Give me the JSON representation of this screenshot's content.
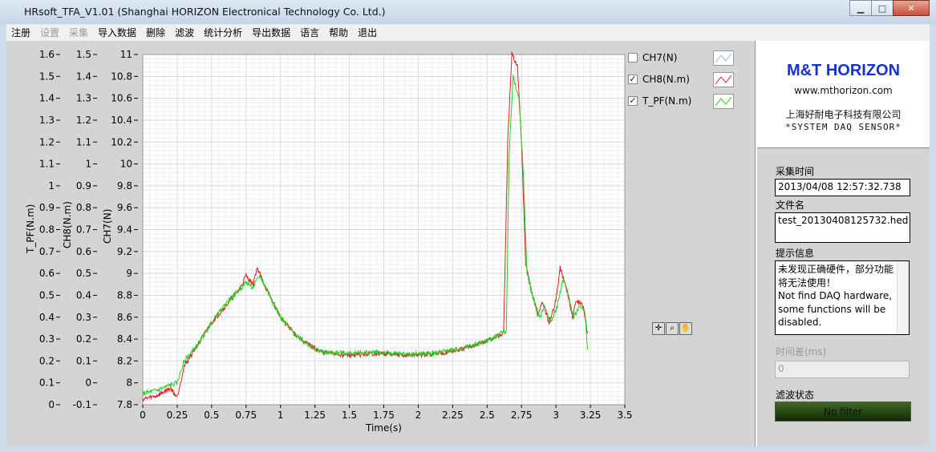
{
  "window": {
    "title": "HRsoft_TFA_V1.01 (Shanghai HORIZON Electronical Technology Co. Ltd.)",
    "min_label": "▁",
    "max_label": "□",
    "close_label": "✕"
  },
  "menu": [
    {
      "label": "注册",
      "enabled": true
    },
    {
      "label": "设置",
      "enabled": false
    },
    {
      "label": "采集",
      "enabled": false
    },
    {
      "label": "导入数据",
      "enabled": true
    },
    {
      "label": "删除",
      "enabled": true
    },
    {
      "label": "滤波",
      "enabled": true
    },
    {
      "label": "统计分析",
      "enabled": true
    },
    {
      "label": "导出数据",
      "enabled": true
    },
    {
      "label": "语言",
      "enabled": true
    },
    {
      "label": "帮助",
      "enabled": true
    },
    {
      "label": "退出",
      "enabled": true
    }
  ],
  "brand": {
    "name": "M&T HORIZON",
    "url": "www.mthorizon.com",
    "company": "上海好耐电子科技有限公司",
    "slogan": "*SYSTEM  DAQ  SENSOR*"
  },
  "panel": {
    "acq_time_label": "采集时间",
    "acq_time_value": "2013/04/08 12:57:32.738",
    "filename_label": "文件名",
    "filename_value": "test_20130408125732.hed",
    "message_label": "提示信息",
    "message_lines": [
      "未发现正确硬件，部分功能",
      "将无法使用！",
      "Not find DAQ hardware,",
      "some functions will be",
      "disabled."
    ],
    "timediff_label": "时间差(ms)",
    "timediff_value": "0",
    "filter_status_label": "滤波状态",
    "filter_status_value": "No filter"
  },
  "colors": {
    "ch7": "#9ab7d3",
    "ch8": "#e02020",
    "tpf": "#22d022",
    "brand": "#1432d2"
  },
  "chart_data": {
    "type": "line",
    "xlabel": "Time(s)",
    "xlim": [
      0,
      3.5
    ],
    "x_ticks": [
      "0",
      "0.25",
      "0.5",
      "0.75",
      "1",
      "1.25",
      "1.5",
      "1.75",
      "2",
      "2.25",
      "2.5",
      "2.75",
      "3",
      "3.25",
      "3.5"
    ],
    "y_axes": [
      {
        "label": "T_PF(N.m)",
        "ylim": [
          0,
          1.6
        ],
        "ticks": [
          "1.6",
          "1.5",
          "1.4",
          "1.3",
          "1.2",
          "1.1",
          "1",
          "0.9",
          "0.8",
          "0.7",
          "0.6",
          "0.5",
          "0.4",
          "0.3",
          "0.2",
          "0.1",
          "0"
        ]
      },
      {
        "label": "CH8(N.m)",
        "ylim": [
          -0.1,
          1.5
        ],
        "ticks": [
          "1.5",
          "1.4",
          "1.3",
          "1.2",
          "1.1",
          "1",
          "0.9",
          "0.8",
          "0.7",
          "0.6",
          "0.5",
          "0.4",
          "0.3",
          "0.2",
          "0.1",
          "0",
          "-0.1"
        ]
      },
      {
        "label": "CH7(N)",
        "ylim": [
          7.8,
          11
        ],
        "ticks": [
          "11",
          "10.8",
          "10.6",
          "10.4",
          "10.2",
          "10",
          "9.8",
          "9.6",
          "9.4",
          "9.2",
          "9",
          "8.8",
          "8.6",
          "8.4",
          "8.2",
          "8",
          "7.8"
        ]
      }
    ],
    "grid": true,
    "legend": [
      {
        "name": "CH7(N)",
        "checked": false
      },
      {
        "name": "CH8(N.m)",
        "checked": true
      },
      {
        "name": "T_PF(N.m)",
        "checked": true
      }
    ],
    "series": [
      {
        "name": "CH8(N.m)",
        "points": [
          [
            0,
            7.85
          ],
          [
            0.1,
            7.88
          ],
          [
            0.2,
            7.95
          ],
          [
            0.25,
            7.87
          ],
          [
            0.3,
            8.15
          ],
          [
            0.4,
            8.35
          ],
          [
            0.5,
            8.55
          ],
          [
            0.6,
            8.7
          ],
          [
            0.7,
            8.85
          ],
          [
            0.75,
            8.98
          ],
          [
            0.8,
            8.9
          ],
          [
            0.83,
            9.05
          ],
          [
            0.9,
            8.85
          ],
          [
            1.0,
            8.6
          ],
          [
            1.1,
            8.45
          ],
          [
            1.2,
            8.35
          ],
          [
            1.3,
            8.28
          ],
          [
            1.5,
            8.25
          ],
          [
            1.7,
            8.27
          ],
          [
            1.9,
            8.25
          ],
          [
            2.1,
            8.26
          ],
          [
            2.3,
            8.3
          ],
          [
            2.5,
            8.38
          ],
          [
            2.62,
            8.45
          ],
          [
            2.65,
            10.2
          ],
          [
            2.68,
            11.0
          ],
          [
            2.72,
            10.9
          ],
          [
            2.75,
            10.2
          ],
          [
            2.78,
            9.1
          ],
          [
            2.82,
            8.85
          ],
          [
            2.87,
            8.6
          ],
          [
            2.9,
            8.75
          ],
          [
            2.95,
            8.55
          ],
          [
            3.0,
            8.75
          ],
          [
            3.03,
            9.05
          ],
          [
            3.08,
            8.85
          ],
          [
            3.12,
            8.6
          ],
          [
            3.15,
            8.75
          ],
          [
            3.2,
            8.7
          ],
          [
            3.23,
            8.45
          ]
        ]
      },
      {
        "name": "T_PF(N.m)",
        "points": [
          [
            0,
            7.9
          ],
          [
            0.1,
            7.93
          ],
          [
            0.2,
            7.98
          ],
          [
            0.25,
            8.0
          ],
          [
            0.3,
            8.2
          ],
          [
            0.4,
            8.35
          ],
          [
            0.5,
            8.55
          ],
          [
            0.6,
            8.72
          ],
          [
            0.7,
            8.85
          ],
          [
            0.75,
            8.92
          ],
          [
            0.8,
            8.87
          ],
          [
            0.85,
            8.98
          ],
          [
            0.92,
            8.8
          ],
          [
            1.0,
            8.6
          ],
          [
            1.1,
            8.45
          ],
          [
            1.2,
            8.35
          ],
          [
            1.3,
            8.28
          ],
          [
            1.5,
            8.27
          ],
          [
            1.7,
            8.28
          ],
          [
            1.9,
            8.26
          ],
          [
            2.1,
            8.27
          ],
          [
            2.3,
            8.31
          ],
          [
            2.5,
            8.38
          ],
          [
            2.64,
            8.48
          ],
          [
            2.66,
            10.1
          ],
          [
            2.69,
            10.8
          ],
          [
            2.73,
            10.6
          ],
          [
            2.76,
            10.0
          ],
          [
            2.79,
            9.0
          ],
          [
            2.83,
            8.8
          ],
          [
            2.88,
            8.6
          ],
          [
            2.92,
            8.7
          ],
          [
            2.96,
            8.55
          ],
          [
            3.01,
            8.7
          ],
          [
            3.05,
            8.95
          ],
          [
            3.09,
            8.8
          ],
          [
            3.13,
            8.6
          ],
          [
            3.17,
            8.7
          ],
          [
            3.21,
            8.65
          ],
          [
            3.23,
            8.3
          ]
        ]
      }
    ]
  },
  "palette_icons": [
    "crosshair-icon",
    "zoom-icon",
    "pan-hand-icon"
  ]
}
